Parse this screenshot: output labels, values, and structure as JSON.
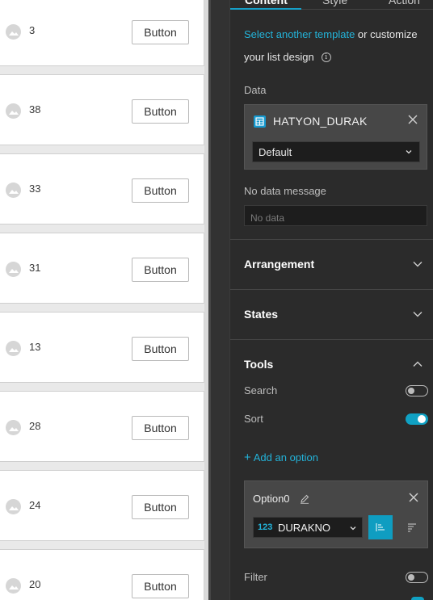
{
  "list_items": [
    {
      "value": "3",
      "button_label": "Button"
    },
    {
      "value": "38",
      "button_label": "Button"
    },
    {
      "value": "33",
      "button_label": "Button"
    },
    {
      "value": "31",
      "button_label": "Button"
    },
    {
      "value": "13",
      "button_label": "Button"
    },
    {
      "value": "28",
      "button_label": "Button"
    },
    {
      "value": "24",
      "button_label": "Button"
    },
    {
      "value": "20",
      "button_label": "Button"
    }
  ],
  "panel": {
    "tabs": [
      {
        "label": "Content",
        "active": true
      },
      {
        "label": "Style",
        "active": false
      },
      {
        "label": "Action",
        "active": false
      }
    ],
    "template": {
      "link_text": "Select another template",
      "rest_text": " or customize",
      "line2": "your list design",
      "info_icon": "info-icon"
    },
    "data": {
      "label": "Data",
      "source_name": "HATYON_DURAK",
      "source_icon": "table-icon",
      "view_selected": "Default"
    },
    "no_data": {
      "label": "No data message",
      "placeholder": "No data"
    },
    "sections": {
      "arrangement": "Arrangement",
      "states": "States",
      "tools": "Tools"
    },
    "tools": {
      "search_label": "Search",
      "search_enabled": false,
      "sort_label": "Sort",
      "sort_enabled": true,
      "add_option": "Add an option",
      "option": {
        "name": "Option0",
        "field_type": "123",
        "field_name": "DURAKNO",
        "sort_direction": "ascending"
      },
      "filter_label": "Filter",
      "filter_enabled": false
    },
    "accent_color": "#10a1c3",
    "link_color": "#23b3d9"
  }
}
